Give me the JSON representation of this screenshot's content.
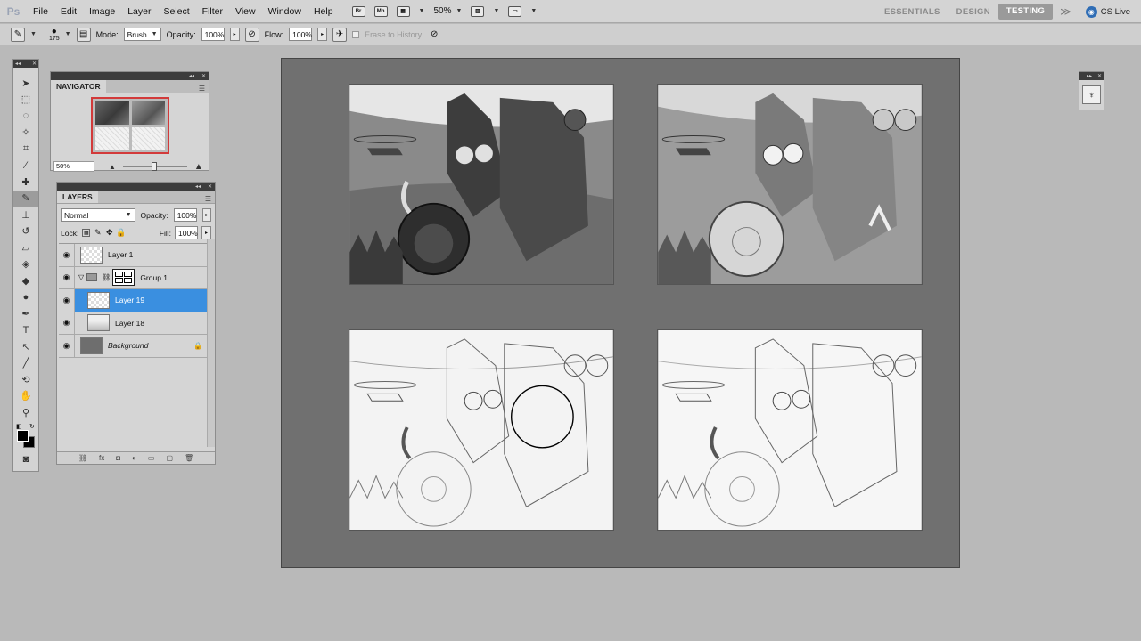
{
  "menubar": {
    "logo": "Ps",
    "items": [
      "File",
      "Edit",
      "Image",
      "Layer",
      "Select",
      "Filter",
      "View",
      "Window",
      "Help"
    ],
    "bridge_label": "Br",
    "minibridge_label": "Mb",
    "zoom": "50%",
    "workspaces": [
      "ESSENTIALS",
      "DESIGN",
      "TESTING"
    ],
    "active_workspace": "TESTING",
    "more": "≫",
    "cslive": "CS Live"
  },
  "options": {
    "brush_size": "175",
    "mode_label": "Mode:",
    "mode_value": "Brush",
    "opacity_label": "Opacity:",
    "opacity_value": "100%",
    "flow_label": "Flow:",
    "flow_value": "100%",
    "erase_history": "Erase to History"
  },
  "navigator": {
    "title": "NAVIGATOR",
    "zoom": "50%"
  },
  "layers": {
    "title": "LAYERS",
    "blend_mode": "Normal",
    "opacity_label": "Opacity:",
    "opacity_value": "100%",
    "lock_label": "Lock:",
    "fill_label": "Fill:",
    "fill_value": "100%",
    "items": [
      {
        "name": "Layer 1"
      },
      {
        "name": "Group 1"
      },
      {
        "name": "Layer 19"
      },
      {
        "name": "Layer 18"
      },
      {
        "name": "Background"
      }
    ]
  },
  "colors": {
    "selected_layer": "#3a8fe0",
    "nav_frame": "#d23a3a",
    "canvas_bg": "#707070"
  }
}
